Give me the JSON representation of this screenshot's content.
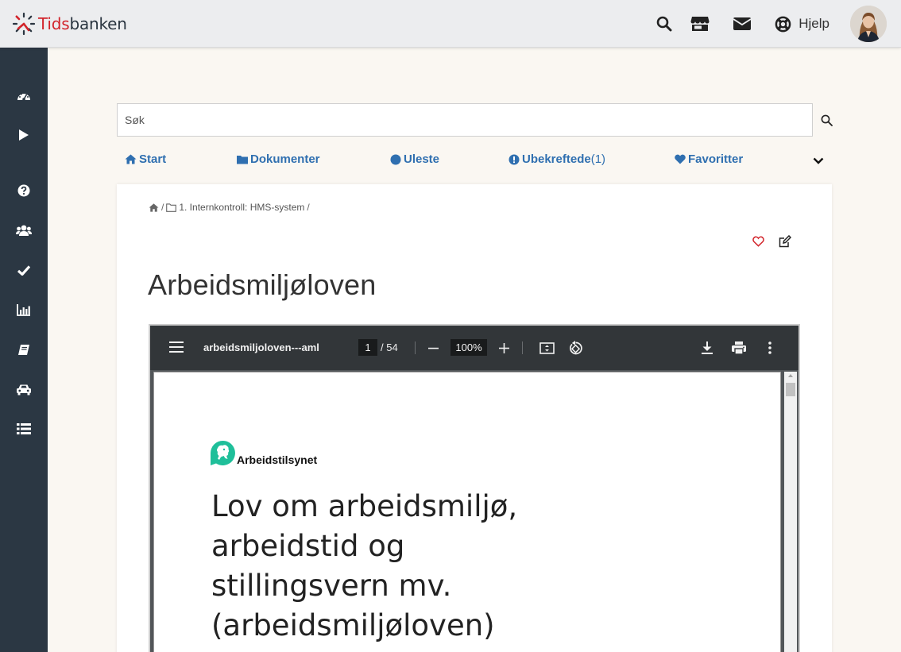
{
  "brand": {
    "prefix": "Tids",
    "suffix": "banken"
  },
  "header": {
    "icons": [
      "search-icon",
      "store-icon",
      "mail-icon",
      "lifebuoy-icon"
    ],
    "help_label": "Hjelp"
  },
  "sidebar": {
    "items": [
      {
        "icon": "dashboard-icon"
      },
      {
        "icon": "play-icon"
      },
      {
        "icon": "question-icon"
      },
      {
        "icon": "users-icon"
      },
      {
        "icon": "check-icon"
      },
      {
        "icon": "bar-chart-icon"
      },
      {
        "icon": "book-icon"
      },
      {
        "icon": "car-icon"
      },
      {
        "icon": "list-icon"
      }
    ]
  },
  "search": {
    "placeholder": "Søk"
  },
  "nav": {
    "start": "Start",
    "documents": "Dokumenter",
    "unread": "Uleste",
    "unconfirmed": "Ubekreftede",
    "unconfirmed_count": "(1)",
    "favorites": "Favoritter"
  },
  "breadcrumb": {
    "folder": "1. Internkontroll: HMS-system",
    "sep": "/"
  },
  "page": {
    "title": "Arbeidsmiljøloven"
  },
  "pdf": {
    "filename": "arbeidsmiljoloven---aml",
    "current_page": "1",
    "total_pages": "/ 54",
    "zoom": "100%",
    "org_name": "Arbeidstilsynet",
    "doc_title_lines": [
      "Lov om arbeidsmiljø,",
      "arbeidstid og",
      "stillingsvern mv.",
      "(arbeidsmiljøloven)"
    ]
  },
  "colors": {
    "brand_red": "#d2232a",
    "sidebar_bg": "#2b3743",
    "link_blue": "#2f6fb0",
    "pdf_toolbar": "#323639",
    "arbeidstilsynet_green": "#1fbf9a"
  }
}
